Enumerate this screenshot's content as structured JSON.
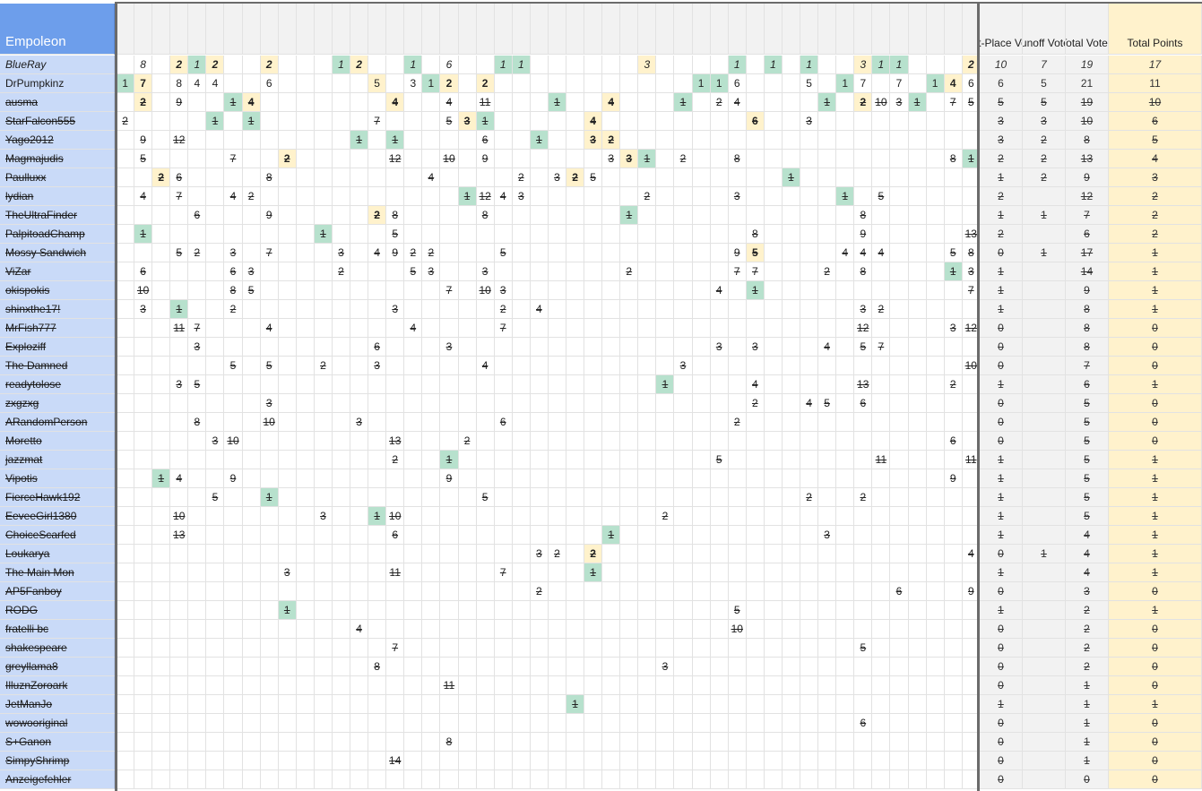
{
  "sheet": {
    "corner_label": "Empoleon",
    "summary_headers": [
      "First-Place Votes",
      "Runoff Votes",
      "Total Votes",
      "Total Points"
    ],
    "num_vote_columns": 48,
    "colors": {
      "name_bg": "#c9daf8",
      "header_bg": "#6d9eeb",
      "green": "#b7e1cd",
      "yellow": "#fff2cc",
      "gray": "#f2f2f2"
    },
    "rows": [
      {
        "name": "BlueRay",
        "style": "it",
        "summary": [
          "10",
          "7",
          "19",
          "17"
        ],
        "summary_strike": false,
        "cells": {
          "1": "8",
          "3": "2|yb",
          "4": "1|g",
          "5": "2|yb",
          "8": "2|yb",
          "12": "1|g",
          "13": "2|yb",
          "16": "1|g",
          "18": "6",
          "21": "1|g",
          "22": "1|g",
          "29": "3|y",
          "34": "1|g",
          "36": "1|g",
          "38": "1|g",
          "41": "3|y",
          "42": "1|g",
          "43": "1|g",
          "47": "2|yb"
        }
      },
      {
        "name": "DrPumpkinz",
        "style": "",
        "summary": [
          "6",
          "5",
          "21",
          "11"
        ],
        "summary_strike": false,
        "cells": {
          "0": "1|g",
          "1": "7|yb",
          "3": "8",
          "4": "4",
          "5": "4",
          "8": "6",
          "14": "5|y",
          "16": "3",
          "17": "1|g",
          "18": "2|yb",
          "20": "2|yb",
          "32": "1|g",
          "33": "1|g",
          "34": "6",
          "38": "5",
          "40": "1|g",
          "41": "7",
          "43": "7",
          "45": "1|g",
          "46": "4|yb",
          "47": "6"
        }
      },
      {
        "name": "ausma",
        "style": "s",
        "summary": [
          "5",
          "5",
          "19",
          "10"
        ],
        "summary_strike": true,
        "cells": {
          "1": "2|yb",
          "3": "9",
          "6": "1|g",
          "7": "4|yb",
          "15": "4|yb",
          "18": "4",
          "20": "11",
          "24": "1|g",
          "27": "4|yb",
          "31": "1|g",
          "33": "2",
          "34": "4",
          "39": "1|g",
          "41": "2|yb",
          "42": "10",
          "43": "3",
          "44": "1|g",
          "46": "7",
          "47": "5"
        }
      },
      {
        "name": "StarFalcon555",
        "style": "s",
        "summary": [
          "3",
          "3",
          "10",
          "6"
        ],
        "summary_strike": true,
        "cells": {
          "0": "2",
          "5": "1|g",
          "7": "1|g",
          "14": "7",
          "18": "5",
          "19": "3|yb",
          "20": "1|g",
          "26": "4|yb",
          "35": "6|yb",
          "38": "3"
        }
      },
      {
        "name": "Yago2012",
        "style": "s",
        "summary": [
          "3",
          "2",
          "8",
          "5"
        ],
        "summary_strike": true,
        "cells": {
          "1": "9",
          "3": "12",
          "13": "1|g",
          "15": "1|g",
          "20": "6",
          "23": "1|g",
          "26": "3|yb",
          "27": "2|yb"
        }
      },
      {
        "name": "Magmajudis",
        "style": "s",
        "summary": [
          "2",
          "2",
          "13",
          "4"
        ],
        "summary_strike": true,
        "cells": {
          "1": "5",
          "6": "7",
          "9": "2|yb",
          "15": "12",
          "18": "10",
          "20": "9",
          "27": "3",
          "28": "3|yb",
          "29": "1|g",
          "31": "2",
          "34": "8",
          "46": "8",
          "47": "1|g"
        }
      },
      {
        "name": "Paulluxx",
        "style": "s",
        "summary": [
          "1",
          "2",
          "9",
          "3"
        ],
        "summary_strike": true,
        "cells": {
          "2": "2|yb",
          "3": "6",
          "8": "8",
          "17": "4",
          "22": "2",
          "24": "3",
          "25": "2|yb",
          "26": "5",
          "37": "1|g"
        }
      },
      {
        "name": "lydian",
        "style": "s",
        "summary": [
          "2",
          "",
          "12",
          "2"
        ],
        "summary_strike": true,
        "cells": {
          "1": "4",
          "3": "7",
          "6": "4",
          "7": "2",
          "19": "1|g",
          "20": "12",
          "21": "4",
          "22": "3",
          "29": "2",
          "34": "3",
          "40": "1|g",
          "42": "5"
        }
      },
      {
        "name": "TheUltraFinder",
        "style": "s",
        "summary": [
          "1",
          "1",
          "7",
          "2"
        ],
        "summary_strike": true,
        "cells": {
          "4": "6",
          "8": "9",
          "14": "2|yb",
          "15": "8",
          "20": "8",
          "28": "1|g",
          "41": "8"
        }
      },
      {
        "name": "PalpitoadChamp",
        "style": "s",
        "summary": [
          "2",
          "",
          "6",
          "2"
        ],
        "summary_strike": true,
        "cells": {
          "1": "1|g",
          "11": "1|g",
          "15": "5",
          "35": "8",
          "41": "9",
          "47": "13"
        }
      },
      {
        "name": "Mossy Sandwich",
        "style": "s",
        "summary": [
          "0",
          "1",
          "17",
          "1"
        ],
        "summary_strike": true,
        "cells": {
          "3": "5",
          "4": "2",
          "6": "3",
          "8": "7",
          "12": "3",
          "14": "4",
          "15": "9",
          "16": "2",
          "17": "2",
          "21": "5",
          "34": "9",
          "35": "5|yb",
          "40": "4",
          "41": "4",
          "42": "4",
          "46": "5",
          "47": "8"
        }
      },
      {
        "name": "ViZar",
        "style": "s",
        "summary": [
          "1",
          "",
          "14",
          "1"
        ],
        "summary_strike": true,
        "cells": {
          "1": "6",
          "6": "6",
          "7": "3",
          "12": "2",
          "16": "5",
          "17": "3",
          "20": "3",
          "28": "2",
          "34": "7",
          "35": "7",
          "39": "2",
          "41": "8",
          "46": "1|g",
          "47": "3"
        }
      },
      {
        "name": "okispokis",
        "style": "s",
        "summary": [
          "1",
          "",
          "9",
          "1"
        ],
        "summary_strike": true,
        "cells": {
          "1": "10",
          "6": "8",
          "7": "5",
          "18": "7",
          "20": "10",
          "21": "3",
          "33": "4",
          "35": "1|g",
          "47": "7"
        }
      },
      {
        "name": "shinxthe17!",
        "style": "s",
        "summary": [
          "1",
          "",
          "8",
          "1"
        ],
        "summary_strike": true,
        "cells": {
          "1": "3",
          "3": "1|g",
          "6": "2",
          "15": "3",
          "21": "2",
          "23": "4",
          "41": "3",
          "42": "2"
        }
      },
      {
        "name": "MrFish777",
        "style": "s",
        "summary": [
          "0",
          "",
          "8",
          "0"
        ],
        "summary_strike": true,
        "cells": {
          "3": "11",
          "4": "7",
          "8": "4",
          "16": "4",
          "21": "7",
          "41": "12",
          "46": "3",
          "47": "12"
        }
      },
      {
        "name": "Exploziff",
        "style": "s",
        "summary": [
          "0",
          "",
          "8",
          "0"
        ],
        "summary_strike": true,
        "cells": {
          "4": "3",
          "14": "6",
          "18": "3",
          "33": "3",
          "35": "3",
          "39": "4",
          "41": "5",
          "42": "7"
        }
      },
      {
        "name": "The Damned",
        "style": "s",
        "summary": [
          "0",
          "",
          "7",
          "0"
        ],
        "summary_strike": true,
        "cells": {
          "6": "5",
          "8": "5",
          "11": "2",
          "14": "3",
          "20": "4",
          "31": "3",
          "47": "10"
        }
      },
      {
        "name": "readytolose",
        "style": "s",
        "summary": [
          "1",
          "",
          "6",
          "1"
        ],
        "summary_strike": true,
        "cells": {
          "3": "3",
          "4": "5",
          "30": "1|g",
          "35": "4",
          "41": "13",
          "46": "2"
        }
      },
      {
        "name": "zxgzxg",
        "style": "s",
        "summary": [
          "0",
          "",
          "5",
          "0"
        ],
        "summary_strike": true,
        "cells": {
          "8": "3",
          "35": "2",
          "38": "4",
          "39": "5",
          "41": "6"
        }
      },
      {
        "name": "ARandomPerson",
        "style": "s",
        "summary": [
          "0",
          "",
          "5",
          "0"
        ],
        "summary_strike": true,
        "cells": {
          "4": "8",
          "8": "10",
          "13": "3",
          "21": "6",
          "34": "2"
        }
      },
      {
        "name": "Moretto",
        "style": "s",
        "summary": [
          "0",
          "",
          "5",
          "0"
        ],
        "summary_strike": true,
        "cells": {
          "5": "3",
          "6": "10",
          "15": "13",
          "19": "2",
          "46": "6"
        }
      },
      {
        "name": "jazzmat",
        "style": "s",
        "summary": [
          "1",
          "",
          "5",
          "1"
        ],
        "summary_strike": true,
        "cells": {
          "15": "2",
          "18": "1|g",
          "33": "5",
          "42": "11",
          "47": "11"
        }
      },
      {
        "name": "Vipotis",
        "style": "s",
        "summary": [
          "1",
          "",
          "5",
          "1"
        ],
        "summary_strike": true,
        "cells": {
          "2": "1|g",
          "3": "4",
          "6": "9",
          "18": "9",
          "46": "9"
        }
      },
      {
        "name": "FierceHawk192",
        "style": "s",
        "summary": [
          "1",
          "",
          "5",
          "1"
        ],
        "summary_strike": true,
        "cells": {
          "5": "5",
          "8": "1|g",
          "20": "5",
          "38": "2",
          "41": "2"
        }
      },
      {
        "name": "EeveeGirl1380",
        "style": "s",
        "summary": [
          "1",
          "",
          "5",
          "1"
        ],
        "summary_strike": true,
        "cells": {
          "3": "10",
          "11": "3",
          "14": "1|g",
          "15": "10",
          "30": "2"
        }
      },
      {
        "name": "ChoiceScarfed",
        "style": "s",
        "summary": [
          "1",
          "",
          "4",
          "1"
        ],
        "summary_strike": true,
        "cells": {
          "3": "13",
          "15": "6",
          "27": "1|g",
          "39": "3"
        }
      },
      {
        "name": "Loukarya",
        "style": "s",
        "summary": [
          "0",
          "1",
          "4",
          "1"
        ],
        "summary_strike": true,
        "cells": {
          "23": "3",
          "24": "2",
          "26": "2|yb",
          "47": "4"
        }
      },
      {
        "name": "The Main Mon",
        "style": "s",
        "summary": [
          "1",
          "",
          "4",
          "1"
        ],
        "summary_strike": true,
        "cells": {
          "9": "3",
          "15": "11",
          "21": "7",
          "26": "1|g"
        }
      },
      {
        "name": "AP5Fanboy",
        "style": "s",
        "summary": [
          "0",
          "",
          "3",
          "0"
        ],
        "summary_strike": true,
        "cells": {
          "23": "2",
          "43": "6",
          "47": "9"
        }
      },
      {
        "name": "RODG",
        "style": "s",
        "summary": [
          "1",
          "",
          "2",
          "1"
        ],
        "summary_strike": true,
        "cells": {
          "9": "1|g",
          "34": "5"
        }
      },
      {
        "name": "fratelli bc",
        "style": "s",
        "summary": [
          "0",
          "",
          "2",
          "0"
        ],
        "summary_strike": true,
        "cells": {
          "13": "4",
          "34": "10"
        }
      },
      {
        "name": "shakespeare",
        "style": "s",
        "summary": [
          "0",
          "",
          "2",
          "0"
        ],
        "summary_strike": true,
        "cells": {
          "15": "7",
          "41": "5"
        }
      },
      {
        "name": "greyllama8",
        "style": "s",
        "summary": [
          "0",
          "",
          "2",
          "0"
        ],
        "summary_strike": true,
        "cells": {
          "14": "8",
          "30": "3"
        }
      },
      {
        "name": "IlluznZoroark",
        "style": "s",
        "summary": [
          "0",
          "",
          "1",
          "0"
        ],
        "summary_strike": true,
        "cells": {
          "18": "11"
        }
      },
      {
        "name": "JetManJo",
        "style": "s",
        "summary": [
          "1",
          "",
          "1",
          "1"
        ],
        "summary_strike": true,
        "cells": {
          "25": "1|g"
        }
      },
      {
        "name": "wowooriginal",
        "style": "s",
        "summary": [
          "0",
          "",
          "1",
          "0"
        ],
        "summary_strike": true,
        "cells": {
          "41": "6"
        }
      },
      {
        "name": "S+Ganon",
        "style": "s",
        "summary": [
          "0",
          "",
          "1",
          "0"
        ],
        "summary_strike": true,
        "cells": {
          "18": "8"
        }
      },
      {
        "name": "SimpyShrimp",
        "style": "s",
        "summary": [
          "0",
          "",
          "1",
          "0"
        ],
        "summary_strike": true,
        "cells": {
          "15": "14"
        }
      },
      {
        "name": "Anzeigefehler",
        "style": "s",
        "summary": [
          "0",
          "",
          "0",
          "0"
        ],
        "summary_strike": true,
        "cells": {}
      }
    ]
  }
}
